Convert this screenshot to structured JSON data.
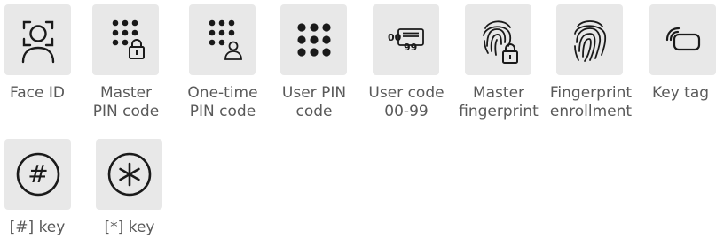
{
  "icons": [
    {
      "icon": "face-id-icon",
      "label": "Face ID"
    },
    {
      "icon": "master-pin-code-icon",
      "label": "Master\nPIN code"
    },
    {
      "icon": "one-time-pin-code-icon",
      "label": "One-time\nPIN code"
    },
    {
      "icon": "user-pin-code-icon",
      "label": "User PIN\ncode"
    },
    {
      "icon": "user-code-00-99-icon",
      "label": "User code\n00-99"
    },
    {
      "icon": "master-fingerprint-icon",
      "label": "Master\nfingerprint"
    },
    {
      "icon": "fingerprint-enrollment-icon",
      "label": "Fingerprint\nenrollment"
    },
    {
      "icon": "key-tag-icon",
      "label": "Key tag"
    },
    {
      "icon": "hash-key-icon",
      "label": "[#] key"
    },
    {
      "icon": "star-key-icon",
      "label": "[*] key"
    }
  ],
  "colors": {
    "tile": "#e8e8e8",
    "icon": "#1a1a1a",
    "label": "#595959"
  }
}
